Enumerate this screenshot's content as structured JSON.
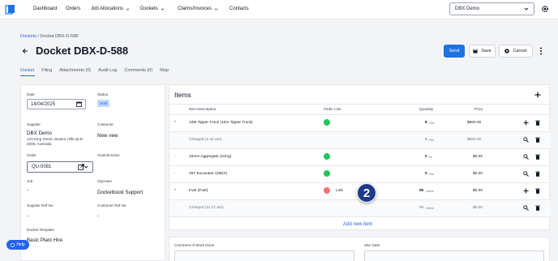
{
  "nav": {
    "items": [
      "Dashboard",
      "Orders",
      "Job Allocations",
      "Dockets",
      "Claims/Invoices",
      "Contacts"
    ],
    "tenant": "DBX Demo"
  },
  "breadcrumb": {
    "link": "Dockets",
    "sep": "/",
    "current": "Docket DBX-D-588"
  },
  "page": {
    "title": "Docket DBX-D-588"
  },
  "actions": {
    "send": "Send",
    "save": "Save",
    "cancel": "Cancel"
  },
  "tabs": [
    "Docket",
    "Filing",
    "Attachments (0)",
    "Audit Log",
    "Comments (0)",
    "Map"
  ],
  "docket": {
    "date_label": "Date",
    "date_value": "14/04/2025",
    "status_label": "Status",
    "status_value": "Draft",
    "supplier_label": "Supplier",
    "supplier_name": "DBX Demo",
    "supplier_address_1": "123 King Street, Bowen Hills QLD",
    "supplier_address_2": "4006, Australia",
    "customer_label": "Customer",
    "customer_value": "New new",
    "order_label": "Order",
    "order_value": "QU-0081",
    "claim_label": "Claim/Invoice",
    "job_label": "Job",
    "job_value": "-",
    "operator_label": "Operator",
    "operator_value": "Docketbook Support",
    "supplier_ref_label": "Supplier Ref No",
    "supplier_ref_value": "-",
    "customer_ref_label": "Customer Ref No",
    "customer_ref_value": "-",
    "template_label": "Docket Template",
    "template_value": "Basic Plant Hire"
  },
  "items": {
    "title": "Items",
    "columns": {
      "description": "Item Description",
      "order_line": "Order Line",
      "quantity": "Quantity",
      "price": "Price"
    },
    "rows": [
      {
        "toggle": "^",
        "description": "10M Tipper Truck (10m Tipper Truck)",
        "status": "ok",
        "qty_num": "8",
        "qty_unit": "Hrs",
        "price": "$800.00",
        "sub": false
      },
      {
        "toggle": "",
        "description": "Charged (1:44 am)",
        "status": "",
        "qty_num": "8",
        "qty_unit": "Hrs",
        "price": "$800.00",
        "sub": true
      },
      {
        "toggle": "–",
        "description": "10mm Aggregate (10Ag)",
        "status": "ok",
        "qty_num": "0",
        "qty_unit": "M",
        "price": "$0.00",
        "sub": false
      },
      {
        "toggle": "–",
        "description": "25T Excavator (25EX)",
        "status": "ok",
        "qty_num": "0",
        "qty_unit": "Hrs",
        "price": "$0.00",
        "sub": false
      },
      {
        "toggle": "^",
        "description": "Fuel (Fuel)",
        "status": "error",
        "link": "Link",
        "qty_num": "90",
        "qty_unit": "Litres",
        "price": "$0.00",
        "sub": false
      },
      {
        "toggle": "",
        "description": "Charged (11:17 am)",
        "status": "",
        "qty_num": "90",
        "qty_unit": "Litres",
        "price": "$0.00",
        "sub": true
      }
    ],
    "add_new": "Add new item"
  },
  "callout": "2",
  "bottom": {
    "comment_label": "Comment of Work Done",
    "site_gate_label": "Site Gate"
  },
  "help": "Help"
}
